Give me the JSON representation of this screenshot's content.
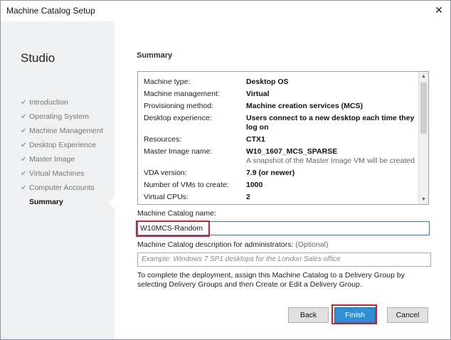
{
  "window": {
    "title": "Machine Catalog Setup",
    "close_glyph": "✕"
  },
  "sidebar": {
    "heading": "Studio",
    "items": [
      {
        "label": "Introduction"
      },
      {
        "label": "Operating System"
      },
      {
        "label": "Machine Management"
      },
      {
        "label": "Desktop Experience"
      },
      {
        "label": "Master Image"
      },
      {
        "label": "Virtual Machines"
      },
      {
        "label": "Computer Accounts"
      },
      {
        "label": "Summary"
      }
    ],
    "check_glyph": "✔"
  },
  "main": {
    "heading": "Summary",
    "summary": [
      {
        "key": "Machine type:",
        "value": "Desktop OS"
      },
      {
        "key": "Machine management:",
        "value": "Virtual"
      },
      {
        "key": "Provisioning method:",
        "value": "Machine creation services (MCS)"
      },
      {
        "key": "Desktop experience:",
        "value": "Users connect to a new desktop each time they log on"
      },
      {
        "key": "Resources:",
        "value": "CTX1"
      },
      {
        "key": "Master Image name:",
        "value": "W10_1607_MCS_SPARSE",
        "note": "A snapshot of the Master Image VM will be created"
      },
      {
        "key": "VDA version:",
        "value": "7.9 (or newer)"
      },
      {
        "key": "Number of VMs to create:",
        "value": "1000"
      },
      {
        "key": "Virtual CPUs:",
        "value": "2"
      }
    ],
    "name_label": "Machine Catalog name:",
    "name_value": "W10MCS-Random",
    "desc_label": "Machine Catalog description for administrators:",
    "desc_optional": "(Optional)",
    "desc_placeholder": "Example: Windows 7 SP1 desktops for the London Sales office",
    "info_text": "To complete the deployment, assign this Machine Catalog to a Delivery Group by selecting Delivery Groups and then Create or Edit a Delivery Group."
  },
  "buttons": {
    "back": "Back",
    "finish": "Finish",
    "cancel": "Cancel"
  },
  "colors": {
    "highlight": "#d0202a",
    "primary": "#2f8fd4",
    "focus_border": "#2b79d6"
  }
}
